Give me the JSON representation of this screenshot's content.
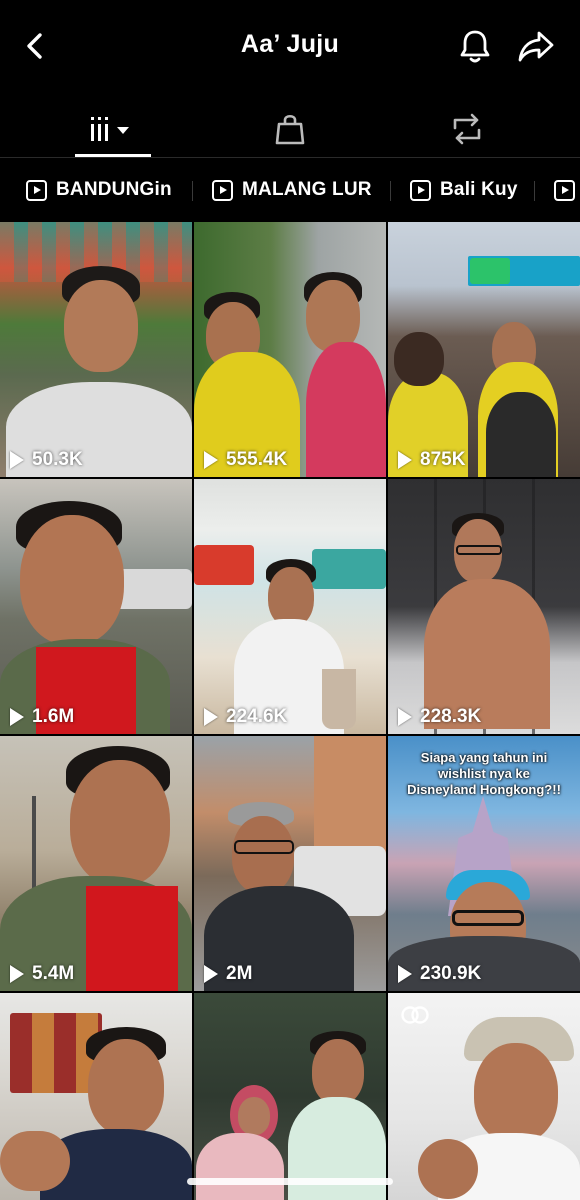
{
  "header": {
    "title": "Aa’ Juju",
    "back_icon": "chevron-left-icon",
    "bell_icon": "bell-icon",
    "share_icon": "share-arrow-icon"
  },
  "tabs": [
    {
      "name": "videos",
      "icon": "grid-sort-icon",
      "active": true
    },
    {
      "name": "shop",
      "icon": "shopping-bag-icon",
      "active": false
    },
    {
      "name": "reposts",
      "icon": "repost-icon",
      "active": false
    }
  ],
  "playlists": [
    {
      "label": "BANDUNGin"
    },
    {
      "label": "MALANG LUR"
    },
    {
      "label": "Bali Kuy"
    },
    {
      "label": ""
    }
  ],
  "videos": [
    {
      "views": "50.3K"
    },
    {
      "views": "555.4K"
    },
    {
      "views": "875K"
    },
    {
      "views": "1.6M"
    },
    {
      "views": "224.6K"
    },
    {
      "views": "228.3K"
    },
    {
      "views": "5.4M"
    },
    {
      "views": "2M"
    },
    {
      "views": "230.9K",
      "overlay": "Siapa yang tahun ini wishlist nya ke Disneyland Hongkong?!!"
    },
    {
      "views": ""
    },
    {
      "views": ""
    },
    {
      "views": "",
      "icon": "loop-icon"
    }
  ],
  "colors": {
    "background": "#000000",
    "text": "#ffffff",
    "divider": "#2a2a2a"
  }
}
